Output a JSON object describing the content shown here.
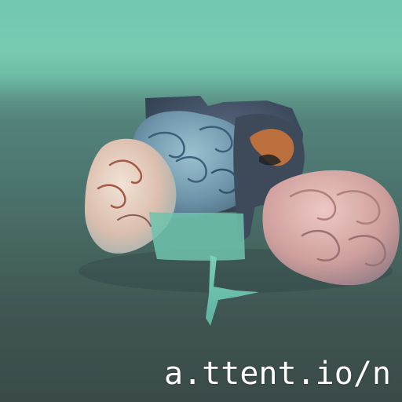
{
  "image": {
    "subject": "stylized-brain-sculpture",
    "palette": {
      "sky": "#72c7b0",
      "ground": "#3f5552",
      "brain_left": "#e7d2c2",
      "brain_blue": "#7fa6b9",
      "brain_dark": "#3f4d63",
      "brain_orange": "#c9743a",
      "brain_right": "#d7a8a6"
    }
  },
  "watermark": {
    "text": "a.ttent.io/n"
  }
}
